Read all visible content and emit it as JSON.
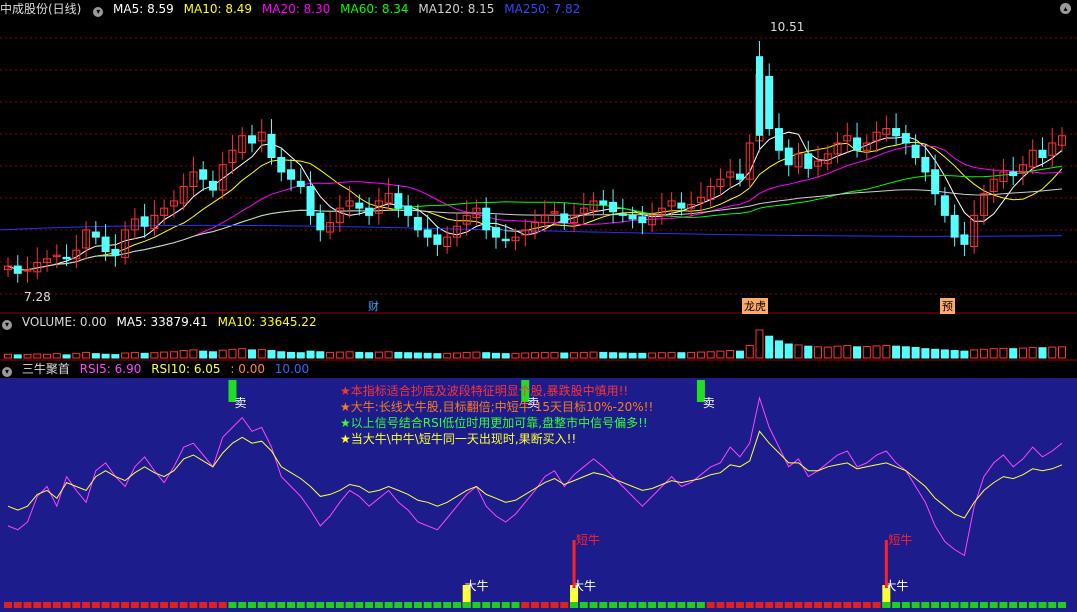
{
  "colors": {
    "ma5": "#ffffff",
    "ma10": "#ffff00",
    "ma20": "#ff00ff",
    "ma60": "#00ff00",
    "ma120": "#cfcfcf",
    "ma250": "#2233ff",
    "up": "#ff3232",
    "down": "#54ffff",
    "rsi5": "#ff44ff",
    "rsi10": "#ffff44",
    "panel_bg": "#1c1c8c",
    "grid": "#8a0000"
  },
  "main_header": {
    "stock": "中成股份(日线)",
    "ma5": "MA5: 8.59",
    "ma10": "MA10: 8.49",
    "ma20": "MA20: 8.30",
    "ma60": "MA60: 8.34",
    "ma120": "MA120: 8.15",
    "ma250": "MA250: 7.82"
  },
  "price_labels": {
    "high": "10.51",
    "low": "7.28"
  },
  "event_markers": {
    "cai": "财",
    "longhu": "龙虎",
    "yu": "预"
  },
  "vol_header": {
    "name": "VOLUME: 0.00",
    "ma5": "MA5: 33879.41",
    "ma10": "MA10: 33645.22"
  },
  "ind_header": {
    "name": "三牛聚首",
    "rsi5": "RSI5: 6.90",
    "rsi10": "RSI10: 6.05",
    "v1": ": 0.00",
    "v2": "10.00"
  },
  "notes": [
    {
      "star": "★",
      "text": "本指标适合抄底及波段特征明显个股,暴跌股中慎用!!",
      "color": "#ff3333"
    },
    {
      "star": "★",
      "text": "大牛:长线大牛股,目标翻倍;中短牛:15天目标10%-20%!!",
      "color": "#ff7a1a",
      "star_color": "#ff7a1a"
    },
    {
      "star": "★",
      "text": "以上信号结合RSI低位时用更加可靠,盘整市中信号偏多!!",
      "color": "#33ff33"
    },
    {
      "star": "★",
      "text": "当大牛\\中牛\\短牛同一天出现时,果断买入!!",
      "color": "#ffff33"
    }
  ],
  "signals": {
    "sell": "卖",
    "big_bull": "大牛",
    "short_bull": "短牛"
  },
  "chart_data": {
    "type": "candlestick",
    "title": "中成股份(日线)",
    "days": 100,
    "close": [
      7.4,
      7.3,
      7.35,
      7.45,
      7.5,
      7.55,
      7.5,
      7.62,
      7.9,
      7.8,
      7.6,
      7.55,
      7.9,
      8.05,
      7.95,
      8.1,
      8.2,
      8.3,
      8.5,
      8.7,
      8.6,
      8.45,
      8.8,
      9.0,
      9.2,
      9.1,
      9.25,
      8.9,
      8.7,
      8.6,
      8.5,
      8.1,
      7.9,
      8.0,
      8.2,
      8.3,
      8.2,
      8.1,
      8.3,
      8.4,
      8.2,
      8.1,
      7.9,
      7.8,
      7.7,
      7.8,
      7.95,
      8.1,
      8.2,
      7.9,
      7.8,
      7.75,
      7.8,
      7.9,
      8.0,
      8.1,
      8.15,
      8.0,
      8.1,
      8.2,
      8.3,
      8.25,
      8.15,
      8.1,
      8.05,
      8.0,
      8.1,
      8.2,
      8.3,
      8.2,
      8.25,
      8.35,
      8.5,
      8.6,
      8.7,
      8.6,
      9.1,
      10.05,
      9.3,
      9.0,
      8.8,
      8.95,
      8.75,
      8.85,
      8.95,
      9.1,
      9.2,
      9.0,
      9.1,
      9.25,
      9.3,
      9.2,
      9.1,
      8.9,
      8.7,
      8.4,
      8.1,
      7.8,
      7.7,
      8.1,
      8.4,
      8.6,
      8.7,
      8.65,
      8.8,
      9.0,
      8.9,
      9.1,
      9.2
    ],
    "low_point": {
      "label": "7.28",
      "value": 7.28
    },
    "high_point": {
      "label": "10.51",
      "value": 10.51
    },
    "ylim": [
      7.0,
      10.8
    ],
    "volume": [
      12,
      10,
      11,
      13,
      12,
      14,
      10,
      15,
      18,
      14,
      12,
      11,
      16,
      18,
      15,
      17,
      19,
      20,
      24,
      26,
      22,
      20,
      25,
      28,
      30,
      26,
      27,
      24,
      20,
      18,
      17,
      22,
      20,
      18,
      19,
      20,
      18,
      17,
      19,
      20,
      18,
      17,
      16,
      15,
      14,
      15,
      16,
      18,
      19,
      17,
      15,
      14,
      15,
      16,
      17,
      18,
      18,
      16,
      17,
      18,
      19,
      18,
      17,
      16,
      15,
      15,
      16,
      17,
      18,
      17,
      18,
      19,
      20,
      22,
      24,
      22,
      40,
      90,
      70,
      55,
      45,
      42,
      38,
      36,
      35,
      38,
      40,
      36,
      37,
      39,
      40,
      38,
      36,
      34,
      30,
      28,
      26,
      24,
      22,
      26,
      28,
      30,
      31,
      30,
      32,
      34,
      33,
      35,
      36
    ],
    "rsi5": [
      30,
      28,
      32,
      45,
      50,
      40,
      55,
      48,
      42,
      58,
      62,
      55,
      50,
      60,
      65,
      58,
      52,
      60,
      70,
      72,
      66,
      60,
      75,
      80,
      85,
      78,
      80,
      70,
      55,
      50,
      45,
      38,
      30,
      35,
      42,
      48,
      45,
      40,
      44,
      48,
      42,
      38,
      32,
      30,
      28,
      34,
      40,
      46,
      50,
      40,
      35,
      32,
      36,
      42,
      48,
      55,
      58,
      50,
      56,
      60,
      64,
      60,
      55,
      50,
      45,
      40,
      45,
      50,
      55,
      50,
      52,
      56,
      60,
      62,
      70,
      65,
      72,
      95,
      80,
      70,
      60,
      64,
      55,
      58,
      62,
      66,
      68,
      60,
      62,
      66,
      68,
      62,
      58,
      50,
      42,
      30,
      22,
      18,
      15,
      40,
      55,
      62,
      66,
      60,
      64,
      70,
      65,
      68,
      72
    ],
    "rsi10": [
      40,
      38,
      40,
      46,
      48,
      44,
      52,
      50,
      48,
      55,
      58,
      55,
      53,
      57,
      60,
      57,
      55,
      58,
      64,
      66,
      63,
      60,
      67,
      72,
      75,
      72,
      73,
      68,
      60,
      57,
      54,
      50,
      45,
      46,
      48,
      51,
      50,
      47,
      48,
      50,
      48,
      46,
      43,
      42,
      40,
      42,
      45,
      48,
      50,
      46,
      44,
      42,
      43,
      46,
      49,
      52,
      54,
      51,
      53,
      55,
      57,
      56,
      54,
      52,
      50,
      48,
      49,
      51,
      53,
      52,
      53,
      54,
      56,
      57,
      61,
      60,
      63,
      78,
      72,
      67,
      62,
      62,
      58,
      58,
      60,
      61,
      62,
      59,
      60,
      61,
      62,
      60,
      58,
      54,
      50,
      44,
      40,
      36,
      34,
      42,
      48,
      52,
      55,
      54,
      56,
      59,
      58,
      59,
      61
    ],
    "signals": [
      {
        "type": "sell",
        "day": 23
      },
      {
        "type": "sell",
        "day": 53
      },
      {
        "type": "sell",
        "day": 71
      },
      {
        "type": "big_bull",
        "day": 47
      },
      {
        "type": "big_bull",
        "day": 58
      },
      {
        "type": "big_bull",
        "day": 90
      },
      {
        "type": "short_bull",
        "day": 58
      },
      {
        "type": "short_bull",
        "day": 90
      }
    ],
    "rsi_ylim": [
      0,
      100
    ]
  }
}
